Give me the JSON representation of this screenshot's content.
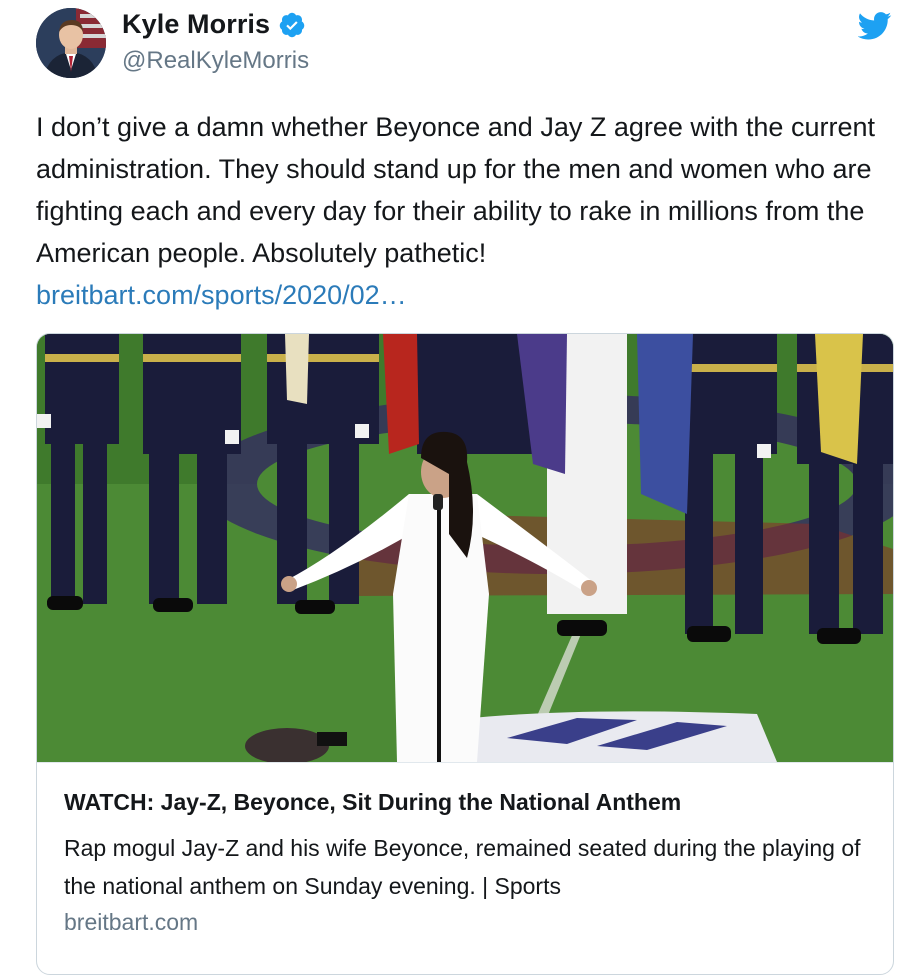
{
  "author": {
    "display_name": "Kyle Morris",
    "handle": "@RealKyleMorris",
    "verified": true
  },
  "tweet": {
    "text": "I don’t give a damn whether Beyonce and Jay Z agree with the current administration. They should stand up for the men and women who are fighting each and every day for their ability to rake in millions from the American people. Absolutely pathetic!",
    "link_text": "breitbart.com/sports/2020/02…"
  },
  "card": {
    "title": "WATCH: Jay-Z, Beyonce, Sit During the National Anthem",
    "description": "Rap mogul Jay-Z and his wife Beyonce, remained seated during the playing of the national anthem on Sunday evening. | Sports",
    "domain": "breitbart.com"
  },
  "icons": {
    "verified": "verified-badge-icon",
    "brand": "twitter-bird-icon"
  },
  "colors": {
    "link": "#2b7bb9",
    "brand_blue": "#1da1f2",
    "secondary_text": "#657786",
    "border": "#ccd6dd"
  }
}
